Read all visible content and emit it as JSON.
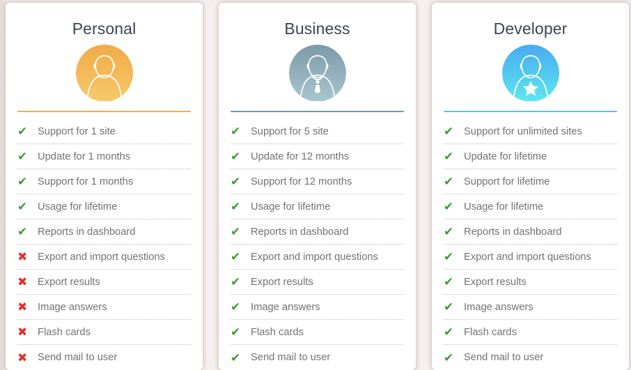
{
  "theme": {
    "page_background": "#f5f0ef",
    "card_background": "#ffffff",
    "title_color": "#3d4451",
    "feature_text_color": "#6f7275",
    "check_color": "#3d9c35",
    "cross_color": "#e03131",
    "separator_color": "#bdbdbd"
  },
  "icons": {
    "check": "✔",
    "cross": "✖",
    "avatar": "avatar-icon"
  },
  "plans": [
    {
      "name": "Personal",
      "accent_color": "#f0ad4e",
      "avatar_gradient_top": "#f0ab47",
      "avatar_gradient_bottom": "#f7c96a",
      "avatar_badge": "none",
      "features": [
        {
          "label": "Support for 1 site",
          "included": true
        },
        {
          "label": "Update for 1 months",
          "included": true
        },
        {
          "label": "Support for 1 months",
          "included": true
        },
        {
          "label": "Usage for lifetime",
          "included": true
        },
        {
          "label": "Reports in dashboard",
          "included": true
        },
        {
          "label": "Export and import questions",
          "included": false
        },
        {
          "label": "Export results",
          "included": false
        },
        {
          "label": "Image answers",
          "included": false
        },
        {
          "label": "Flash cards",
          "included": false
        },
        {
          "label": "Send mail to user",
          "included": false
        }
      ]
    },
    {
      "name": "Business",
      "accent_color": "#6e98a8",
      "avatar_gradient_top": "#7d9aa8",
      "avatar_gradient_bottom": "#a8c6cf",
      "avatar_badge": "tie",
      "features": [
        {
          "label": "Support for 5 site",
          "included": true
        },
        {
          "label": "Update for 12 months",
          "included": true
        },
        {
          "label": "Support for 12 months",
          "included": true
        },
        {
          "label": "Usage for lifetime",
          "included": true
        },
        {
          "label": "Reports in dashboard",
          "included": true
        },
        {
          "label": "Export and import questions",
          "included": true
        },
        {
          "label": "Export results",
          "included": true
        },
        {
          "label": "Image answers",
          "included": true
        },
        {
          "label": "Flash cards",
          "included": true
        },
        {
          "label": "Send mail to user",
          "included": true
        }
      ]
    },
    {
      "name": "Developer",
      "accent_color": "#5bc0eb",
      "avatar_gradient_top": "#49a9f0",
      "avatar_gradient_bottom": "#5ce8f0",
      "avatar_badge": "star",
      "features": [
        {
          "label": "Support for unlimited sites",
          "included": true
        },
        {
          "label": "Update for lifetime",
          "included": true
        },
        {
          "label": "Support for lifetime",
          "included": true
        },
        {
          "label": "Usage for lifetime",
          "included": true
        },
        {
          "label": "Reports in dashboard",
          "included": true
        },
        {
          "label": "Export and import questions",
          "included": true
        },
        {
          "label": "Export results",
          "included": true
        },
        {
          "label": "Image answers",
          "included": true
        },
        {
          "label": "Flash cards",
          "included": true
        },
        {
          "label": "Send mail to user",
          "included": true
        }
      ]
    }
  ]
}
